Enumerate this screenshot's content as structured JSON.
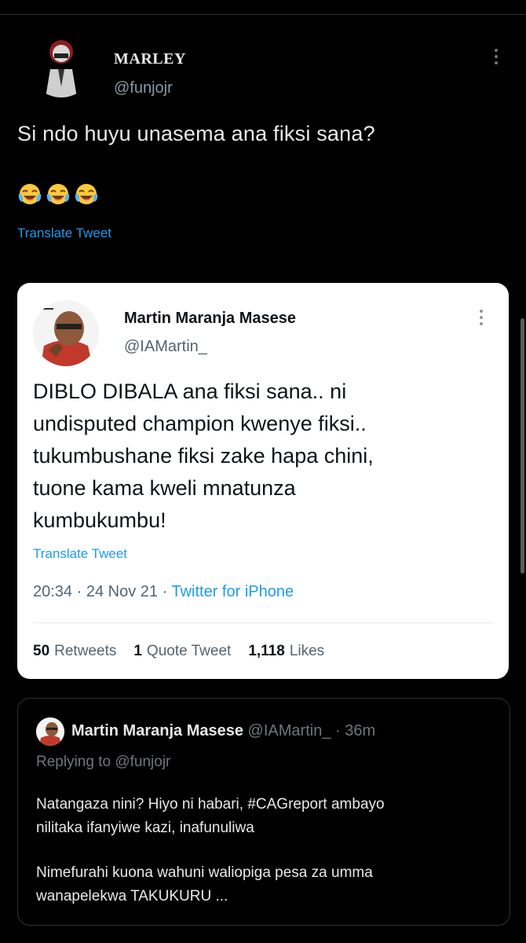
{
  "main_tweet": {
    "name": "MARLEY",
    "handle": "@funjojr",
    "text": "Si ndo huyu unasema ana fiksi sana?",
    "emojis": [
      "face-with-tears-of-joy",
      "face-with-tears-of-joy",
      "face-with-tears-of-joy"
    ],
    "translate": "Translate Tweet"
  },
  "quoted_tweet": {
    "name": "Martin Maranja Masese",
    "handle": "@IAMartin_",
    "text_lines": [
      "DIBLO DIBALA ana fiksi sana.. ni",
      "undisputed champion kwenye fiksi..",
      "tukumbushane fiksi zake hapa chini,",
      "tuone kama kweli mnatunza",
      "kumbukumbu!"
    ],
    "translate": "Translate Tweet",
    "time": "20:34",
    "separator": "·",
    "date": "24 Nov 21",
    "source": "Twitter for iPhone",
    "stats": {
      "retweets_count": "50",
      "retweets_label": "Retweets",
      "quotes_count": "1",
      "quotes_label": "Quote Tweet",
      "likes_count": "1,118",
      "likes_label": "Likes"
    }
  },
  "reply_tweet": {
    "name": "Martin Maranja Masese",
    "handle": "@IAMartin_",
    "separator": "·",
    "time": "36m",
    "replying_label": "Replying to",
    "replying_to": "@funjojr",
    "paragraph_1_lines": [
      "Natangaza nini? Hiyo ni habari, #CAGreport ambayo",
      "nilitaka ifanyiwe kazi, inafunuliwa"
    ],
    "paragraph_2_lines": [
      "Nimefurahi kuona wahuni waliopiga pesa za umma",
      "wanapelekwa TAKUKURU ..."
    ]
  },
  "colors": {
    "background": "#000000",
    "link_blue": "#1d9bf0",
    "muted_gray": "#71767b",
    "card_white": "#ffffff"
  }
}
